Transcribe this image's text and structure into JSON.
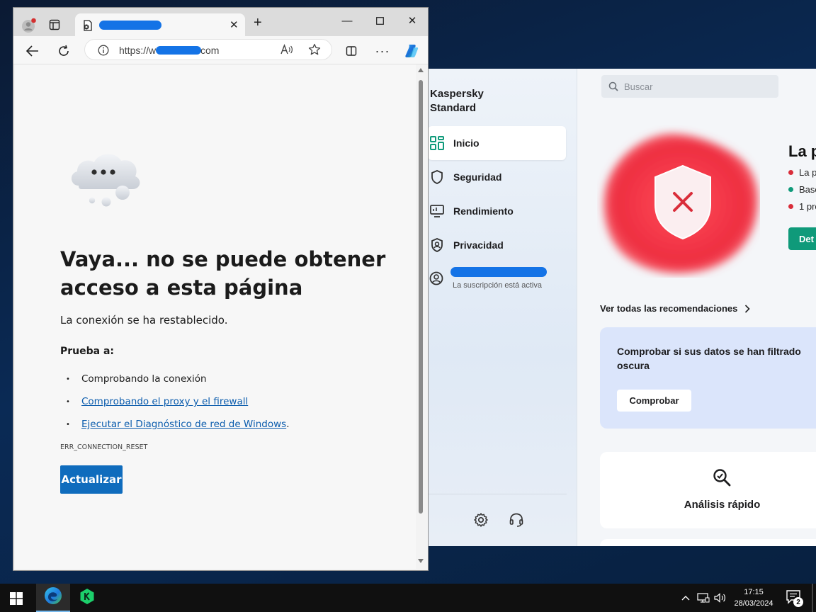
{
  "kaspersky": {
    "app_title": "Kaspersky\nStandard",
    "nav": [
      {
        "label": "Inicio",
        "icon": "dashboard-icon",
        "active": true
      },
      {
        "label": "Seguridad",
        "icon": "shield-icon"
      },
      {
        "label": "Rendimiento",
        "icon": "monitor-icon"
      },
      {
        "label": "Privacidad",
        "icon": "privacy-shield-icon"
      }
    ],
    "account": {
      "subscription": "La suscripción está activa"
    },
    "search_placeholder": "Buscar",
    "status": {
      "title": "La p",
      "lines": [
        {
          "text": "La p",
          "color": "#d92d3a"
        },
        {
          "text": "Base",
          "color": "#0f9a7a"
        },
        {
          "text": "1 pro",
          "color": "#d92d3a"
        }
      ],
      "details_button": "Det"
    },
    "recommendations_link": "Ver todas las recomendaciones",
    "leak_card": {
      "text": "Comprobar si sus datos se han filtrado\noscura",
      "button": "Comprobar"
    },
    "quick_scan": {
      "label": "Análisis rápido"
    }
  },
  "edge": {
    "tab": {
      "title": ""
    },
    "address": {
      "prefix": "https://w",
      "suffix": "com"
    },
    "page": {
      "heading": "Vaya... no se puede obtener acceso a esta página",
      "subtitle": "La conexión se ha restablecido.",
      "try_label": "Prueba a:",
      "suggestions": [
        {
          "text": "Comprobando la conexión",
          "link": false
        },
        {
          "text": "Comprobando el proxy y el firewall",
          "link": true
        },
        {
          "text": "Ejecutar el Diagnóstico de red de Windows",
          "link": true,
          "trailing": "."
        }
      ],
      "error_code": "ERR_CONNECTION_RESET",
      "reload_button": "Actualizar"
    }
  },
  "taskbar": {
    "time": "17:15",
    "date": "28/03/2024",
    "notification_count": "2",
    "apps": [
      "edge-icon",
      "kaspersky-icon"
    ]
  },
  "colors": {
    "accent_blue": "#0f6cbd",
    "link": "#0b5cad",
    "kaspersky_green": "#0f9a7a",
    "alert_red": "#e8303e",
    "redaction": "#1473e6"
  }
}
